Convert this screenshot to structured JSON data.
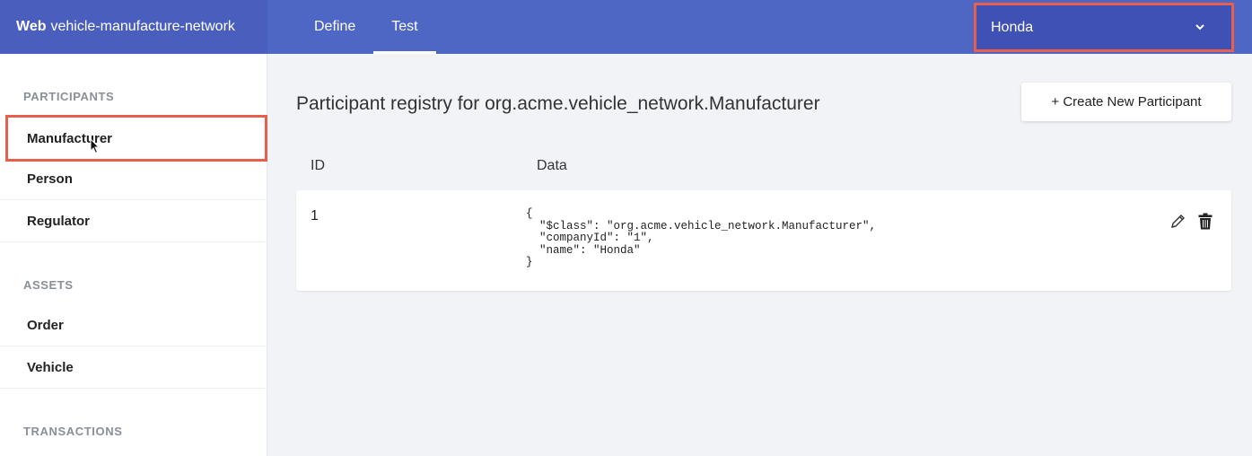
{
  "header": {
    "brand_bold": "Web",
    "brand_name": "vehicle-manufacture-network",
    "tabs": [
      {
        "label": "Define"
      },
      {
        "label": "Test"
      }
    ],
    "identity": "Honda"
  },
  "sidebar": {
    "participants_title": "PARTICIPANTS",
    "participants": [
      "Manufacturer",
      "Person",
      "Regulator"
    ],
    "assets_title": "ASSETS",
    "assets": [
      "Order",
      "Vehicle"
    ],
    "transactions_title": "TRANSACTIONS"
  },
  "main": {
    "title": "Participant registry for org.acme.vehicle_network.Manufacturer",
    "create_button": "+ Create New Participant",
    "columns": {
      "id": "ID",
      "data": "Data"
    },
    "rows": [
      {
        "id": "1",
        "data": "{\n  \"$class\": \"org.acme.vehicle_network.Manufacturer\",\n  \"companyId\": \"1\",\n  \"name\": \"Honda\"\n}"
      }
    ]
  },
  "icons": {
    "identity_dropdown": "chevron-down-icon",
    "edit": "pencil-icon",
    "delete": "trash-icon",
    "cursor": "mouse-pointer-icon"
  },
  "colors": {
    "header": "#4e66c4",
    "brand": "#4a5fbd",
    "identity_bg": "#3f51b5",
    "highlight": "#e8604c"
  }
}
